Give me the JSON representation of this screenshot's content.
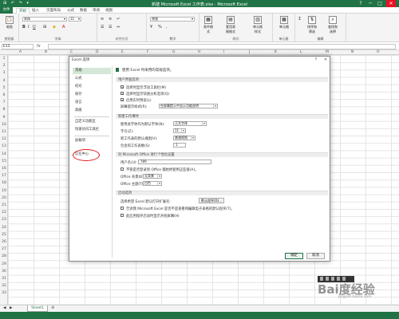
{
  "titlebar": {
    "title": "新建 Microsoft Excel 工作表.xlsx - Microsoft Excel",
    "quick_access": "⊞ ↶ ↷ ▾",
    "help": "?",
    "min": "─",
    "max": "□",
    "close": "✕",
    "accent": "#217346"
  },
  "tabs": [
    "文件",
    "开始",
    "插入",
    "页面布局",
    "公式",
    "数据",
    "审阅",
    "视图"
  ],
  "ribbon": {
    "paste": "粘贴",
    "clipboard": "剪贴板",
    "font_name": "宋体",
    "font_size": "11",
    "font_group": "字体",
    "align_group": "对齐方式",
    "number_format": "常规",
    "number_group": "数字",
    "cond_format": "条件格式",
    "table_format": "套用表格格式",
    "cell_style": "单元格样式",
    "style_group": "样式",
    "cells_label": "单元格",
    "cells_group": "单元格",
    "sort": "排序和筛选",
    "find": "查找和选择",
    "edit_group": "编辑"
  },
  "formula_bar": {
    "name_box": "E15",
    "fx": "fx"
  },
  "columns": [
    "A",
    "B",
    "C",
    "D",
    "E",
    "F",
    "G",
    "H",
    "I",
    "J",
    "K",
    "L",
    "M",
    "N",
    "O"
  ],
  "rows": [
    "1",
    "2",
    "3",
    "4",
    "5",
    "6",
    "7",
    "8",
    "9",
    "10",
    "11",
    "12",
    "13",
    "14",
    "15",
    "16",
    "17",
    "18",
    "19",
    "20",
    "21",
    "22",
    "23",
    "24",
    "25",
    "26",
    "27",
    "28",
    "29",
    "30",
    "31",
    "32",
    "33"
  ],
  "sheet_tab": "Sheet1",
  "dialog": {
    "title": "Excel 选项",
    "help": "?",
    "close": "✕",
    "nav": [
      "常规",
      "公式",
      "校对",
      "保存",
      "语言",
      "高级",
      "自定义功能区",
      "快速访问工具栏",
      "加载项",
      "信任中心"
    ],
    "intro": "使用 Excel 时采用的常规选项。",
    "sections": {
      "ui": "用户界面选项",
      "new_wb": "新建工作簿时",
      "personalize": "对 Microsoft Office 进行个性化设置",
      "startup": "启动选项"
    },
    "ui_options": [
      {
        "label": "选择时显示浮动工具栏(M)",
        "checked": true
      },
      {
        "label": "选择时显示快速分析选项(Q)",
        "checked": true
      },
      {
        "label": "启用实时预览(L)",
        "checked": true
      }
    ],
    "screentip_label": "屏幕提示样式(R):",
    "screentip_value": "在屏幕提示中显示功能说明",
    "new_wb_options": [
      {
        "label": "使用此字体作为默认字体(N):",
        "value": "正文字体"
      },
      {
        "label": "字号(Z):",
        "value": "11"
      },
      {
        "label": "新工作表的默认视图(V):",
        "value": "普通视图"
      },
      {
        "label": "包含的工作表数(S):",
        "value": "1"
      }
    ],
    "username_label": "用户名(U):",
    "username_value": "789",
    "always_use_label": "不管是否登录到 Office 都始终使用这些值(A)。",
    "office_bg_label": "Office 背景(B):",
    "office_bg_value": "无背景",
    "office_theme_label": "Office 主题(T):",
    "office_theme_value": "白色",
    "startup_ext_label": "选择希望 Excel 默认打开扩展名:",
    "startup_ext_button": "默认程序(D)...",
    "startup_options": [
      {
        "label": "告诉我 Microsoft Excel 是否不是查看和编辑电子表格的默认程序(T)。",
        "checked": false
      },
      {
        "label": "此应用程序启动时显示开始屏幕(H)",
        "checked": false
      }
    ],
    "ok": "确定",
    "cancel": "取消"
  },
  "watermark": {
    "text": "Bai度经验",
    "sub": "jingyan.baidu.com"
  }
}
